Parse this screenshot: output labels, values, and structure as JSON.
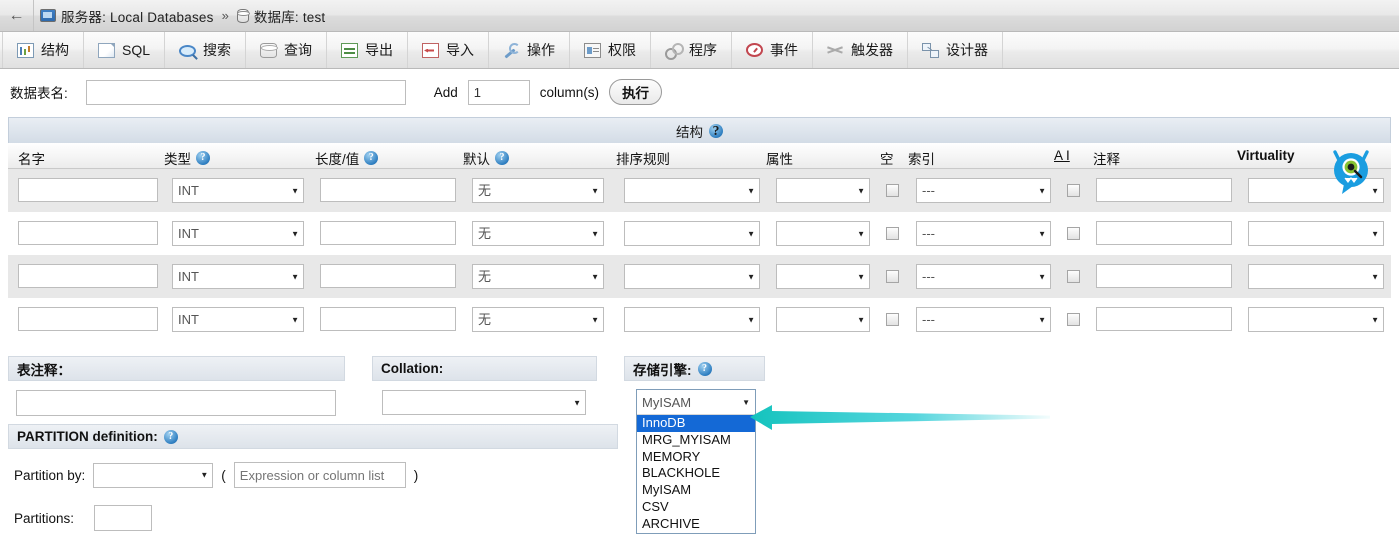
{
  "breadcrumb": {
    "back_label": "←",
    "server_icon": "server-icon",
    "server_text": "服务器: Local Databases",
    "separator": "»",
    "db_icon": "database-icon",
    "db_text": "数据库: test"
  },
  "tabs": [
    {
      "label": "结构",
      "icon": "structure-icon"
    },
    {
      "label": "SQL",
      "icon": "sql-icon"
    },
    {
      "label": "搜索",
      "icon": "search-icon"
    },
    {
      "label": "查询",
      "icon": "query-icon"
    },
    {
      "label": "导出",
      "icon": "export-icon"
    },
    {
      "label": "导入",
      "icon": "import-icon"
    },
    {
      "label": "操作",
      "icon": "wrench-icon"
    },
    {
      "label": "权限",
      "icon": "privileges-icon"
    },
    {
      "label": "程序",
      "icon": "routines-icon"
    },
    {
      "label": "事件",
      "icon": "events-icon"
    },
    {
      "label": "触发器",
      "icon": "triggers-icon"
    },
    {
      "label": "设计器",
      "icon": "designer-icon"
    }
  ],
  "create_table": {
    "name_label": "数据表名:",
    "name_value": "",
    "name_placeholder": "",
    "add_label": "Add",
    "add_value": "1",
    "columns_label": "column(s)",
    "go_label": "执行"
  },
  "structure": {
    "panel_title": "结构",
    "panel_help_icon": "help-icon",
    "columns": [
      {
        "label": "名字",
        "help": false,
        "bold": false
      },
      {
        "label": "类型",
        "help": true,
        "bold": false
      },
      {
        "label": "长度/值",
        "help": true,
        "bold": false
      },
      {
        "label": "默认",
        "help": true,
        "bold": false
      },
      {
        "label": "排序规则",
        "help": false,
        "bold": false
      },
      {
        "label": "属性",
        "help": false,
        "bold": false
      },
      {
        "label": "空",
        "help": false,
        "bold": false
      },
      {
        "label": "索引",
        "help": false,
        "bold": false
      },
      {
        "label": "A I",
        "help": false,
        "bold": false
      },
      {
        "label": "注释",
        "help": false,
        "bold": false
      },
      {
        "label": "Virtuality",
        "help": false,
        "bold": true
      }
    ],
    "rows": [
      {
        "name": "",
        "type": "INT",
        "length": "",
        "default": "无",
        "collation": "",
        "attributes": "",
        "null": false,
        "index": "---",
        "ai": false,
        "comments": "",
        "virtuality": ""
      },
      {
        "name": "",
        "type": "INT",
        "length": "",
        "default": "无",
        "collation": "",
        "attributes": "",
        "null": false,
        "index": "---",
        "ai": false,
        "comments": "",
        "virtuality": ""
      },
      {
        "name": "",
        "type": "INT",
        "length": "",
        "default": "无",
        "collation": "",
        "attributes": "",
        "null": false,
        "index": "---",
        "ai": false,
        "comments": "",
        "virtuality": ""
      },
      {
        "name": "",
        "type": "INT",
        "length": "",
        "default": "无",
        "collation": "",
        "attributes": "",
        "null": false,
        "index": "---",
        "ai": false,
        "comments": "",
        "virtuality": ""
      }
    ]
  },
  "table_options": {
    "comments_label": "表注释：",
    "comments_value": "",
    "collation_label": "Collation:",
    "collation_value": "",
    "engine_label": "存储引擎:",
    "engine_help_icon": "help-icon",
    "engine_selected": "MyISAM",
    "engine_options": [
      "InnoDB",
      "MRG_MYISAM",
      "MEMORY",
      "BLACKHOLE",
      "MyISAM",
      "CSV",
      "ARCHIVE"
    ],
    "engine_highlighted": "InnoDB"
  },
  "partition": {
    "title": "PARTITION definition:",
    "help_icon": "help-icon",
    "by_label": "Partition by:",
    "by_value": "",
    "paren_open": "(",
    "expr_value": "",
    "expr_placeholder": "Expression or column list",
    "paren_close": ")",
    "partitions_label": "Partitions:",
    "partitions_value": ""
  },
  "annotation": {
    "arrow_icon": "left-arrow-annotation",
    "arrow_color": "#1ec8d2"
  },
  "overlay": {
    "monster_icon": "monster-extension-icon",
    "monster_color": "#1a9de0"
  },
  "colors": {
    "highlight_blue": "#1469d6",
    "toolbar_gray": "#ececec",
    "panel_blue_gray": "#dde3ea",
    "row_alt": "#e8e8e8"
  }
}
